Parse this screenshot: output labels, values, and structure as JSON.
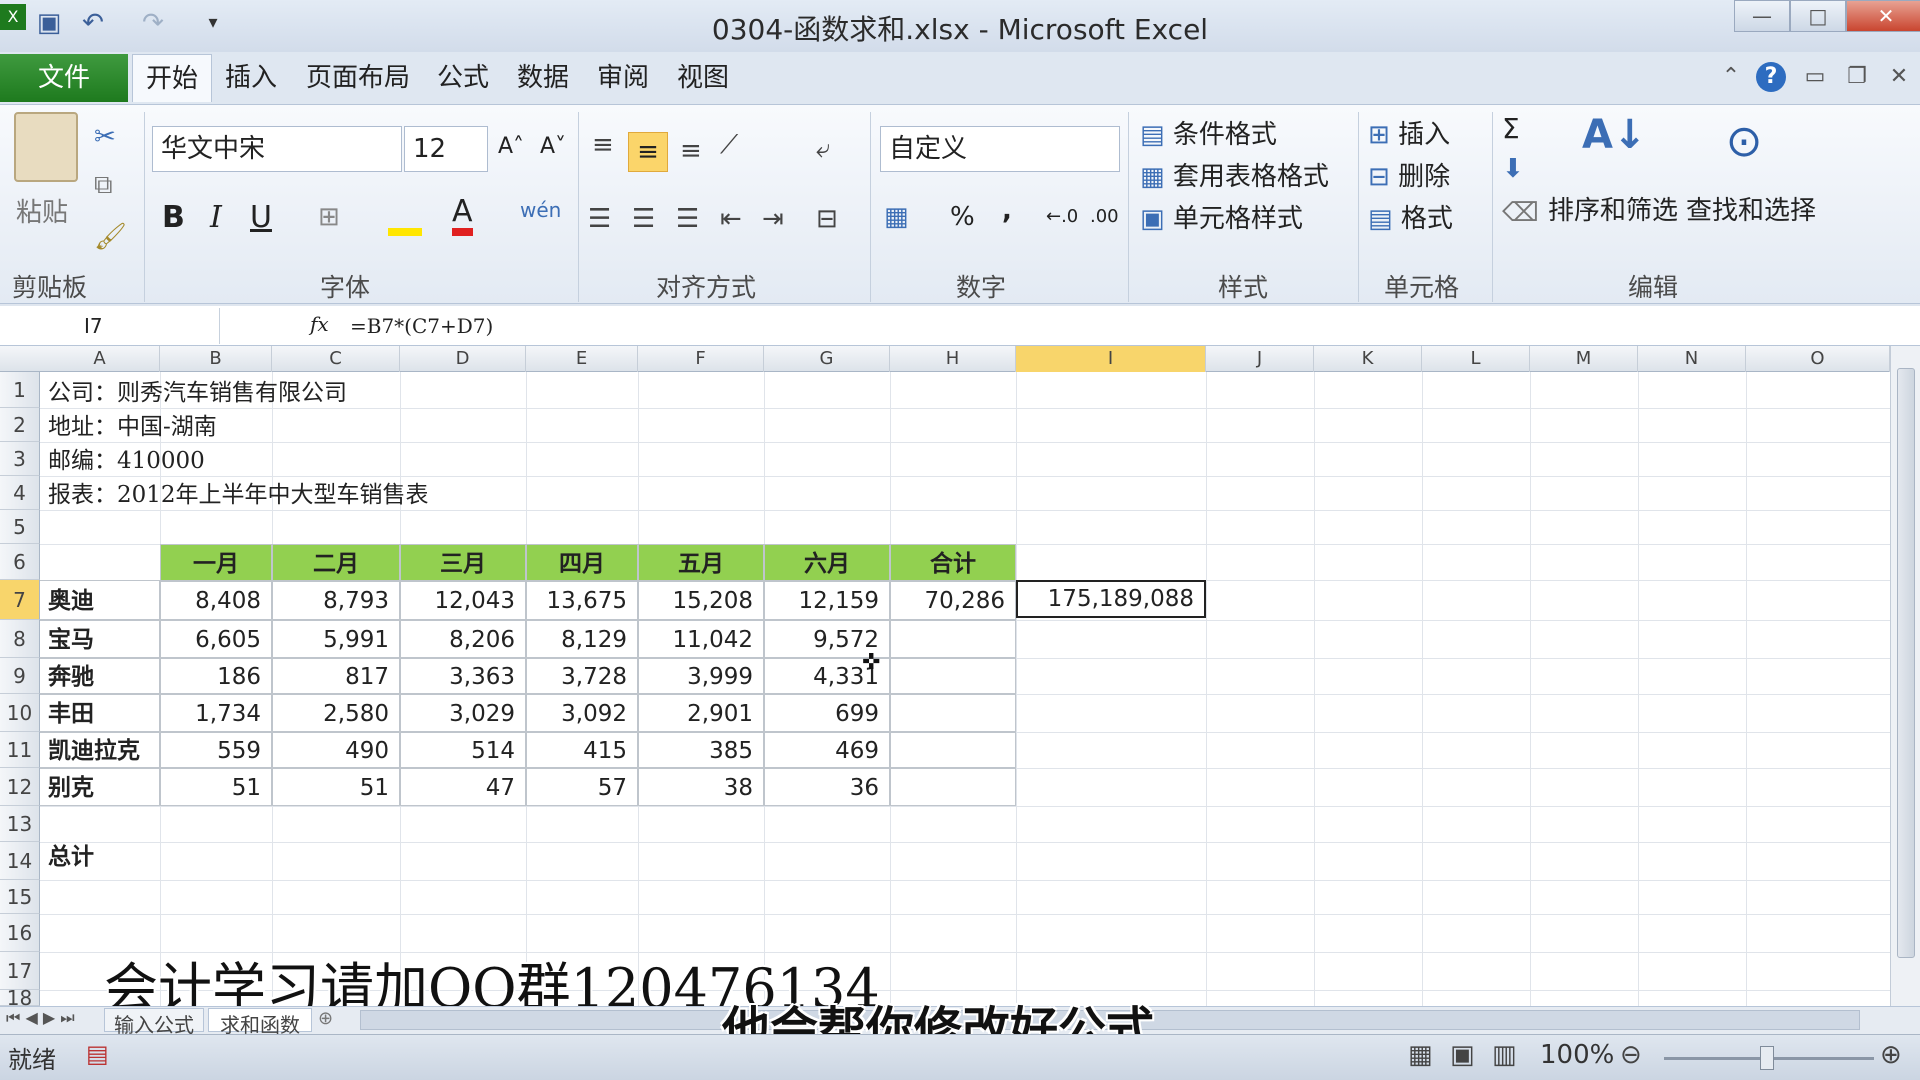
{
  "window": {
    "title": "0304-函数求和.xlsx - Microsoft Excel",
    "min_label": "—",
    "max_label": "□",
    "close_label": "✕"
  },
  "qat": {
    "save_icon": "💾",
    "undo_icon": "↶",
    "redo_icon": "↷",
    "customize_icon": "▾",
    "app_icon": "X"
  },
  "tabs": {
    "file": "文件",
    "home": "开始",
    "insert": "插入",
    "page_layout": "页面布局",
    "formulas": "公式",
    "data": "数据",
    "review": "审阅",
    "view": "视图"
  },
  "ribbon": {
    "clipboard": {
      "paste": "粘贴",
      "label": "剪贴板"
    },
    "font": {
      "name": "华文中宋",
      "size": "12",
      "bold": "B",
      "italic": "I",
      "underline": "U",
      "grow": "A˄",
      "shrink": "A˅",
      "font_color_glyph": "A",
      "phonetic": "wén",
      "label": "字体"
    },
    "align": {
      "label": "对齐方式"
    },
    "number": {
      "format": "自定义",
      "percent": "%",
      "comma": ",",
      "inc_dec": "←.0\n.00",
      "dec_dec": ".00\n→.0",
      "label": "数字"
    },
    "styles": {
      "cond": "条件格式",
      "table": "套用表格格式",
      "cell": "单元格样式",
      "label": "样式"
    },
    "cells": {
      "insert": "插入",
      "delete": "删除",
      "format": "格式",
      "label": "单元格"
    },
    "editing": {
      "sigma": "Σ",
      "sort": "排序和筛选",
      "find": "查找和选择",
      "label": "编辑"
    }
  },
  "formula_bar": {
    "name_box": "I7",
    "fx": "fx",
    "formula": "=B7*(C7+D7)"
  },
  "columns": [
    "A",
    "B",
    "C",
    "D",
    "E",
    "F",
    "G",
    "H",
    "I",
    "J",
    "K",
    "L",
    "M",
    "N",
    "O"
  ],
  "rows": [
    "1",
    "2",
    "3",
    "4",
    "5",
    "6",
    "7",
    "8",
    "9",
    "10",
    "11",
    "12",
    "13",
    "14",
    "15",
    "16",
    "17",
    "18"
  ],
  "info": {
    "company": "公司：则秀汽车销售有限公司",
    "address": "地址：中国-湖南",
    "zip": "邮编：410000",
    "report": "报表：2012年上半年中大型车销售表"
  },
  "table": {
    "headers": [
      "一月",
      "二月",
      "三月",
      "四月",
      "五月",
      "六月",
      "合计"
    ],
    "data": [
      {
        "brand": "奥迪",
        "values": [
          "8,408",
          "8,793",
          "12,043",
          "13,675",
          "15,208",
          "12,159",
          "70,286"
        ]
      },
      {
        "brand": "宝马",
        "values": [
          "6,605",
          "5,991",
          "8,206",
          "8,129",
          "11,042",
          "9,572",
          ""
        ]
      },
      {
        "brand": "奔驰",
        "values": [
          "186",
          "817",
          "3,363",
          "3,728",
          "3,999",
          "4,331",
          ""
        ]
      },
      {
        "brand": "丰田",
        "values": [
          "1,734",
          "2,580",
          "3,029",
          "3,092",
          "2,901",
          "699",
          ""
        ]
      },
      {
        "brand": "凯迪拉克",
        "values": [
          "559",
          "490",
          "514",
          "415",
          "385",
          "469",
          ""
        ]
      },
      {
        "brand": "别克",
        "values": [
          "51",
          "51",
          "47",
          "57",
          "38",
          "36",
          ""
        ]
      }
    ],
    "total_label": "总计",
    "i7_value": "175,189,088"
  },
  "sheets": {
    "tab1": "输入公式",
    "tab2": "求和函数"
  },
  "status": {
    "ready": "就绪",
    "zoom": "100%"
  },
  "captions": {
    "ad": "会计学习请加QQ群120476134",
    "subtitle": "他会帮你修改好公式"
  }
}
